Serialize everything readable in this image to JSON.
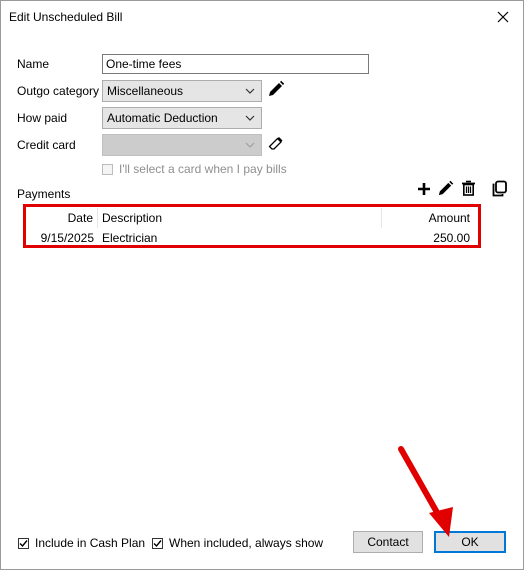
{
  "window": {
    "title": "Edit Unscheduled Bill"
  },
  "form": {
    "name_label": "Name",
    "name_value": "One-time fees",
    "category_label": "Outgo category",
    "category_value": "Miscellaneous",
    "how_paid_label": "How paid",
    "how_paid_value": "Automatic Deduction",
    "credit_card_label": "Credit card",
    "credit_card_value": "",
    "select_card_later_label": "I'll select a card when I pay bills",
    "select_card_later_checked": false
  },
  "payments": {
    "label": "Payments",
    "columns": {
      "date": "Date",
      "description": "Description",
      "amount": "Amount"
    },
    "rows": [
      {
        "date": "9/15/2025",
        "description": "Electrician",
        "amount": "250.00"
      }
    ]
  },
  "footer": {
    "include_cash_plan_label": "Include in Cash Plan",
    "include_cash_plan_checked": true,
    "always_show_label": "When included, always show",
    "always_show_checked": true,
    "contact_label": "Contact",
    "ok_label": "OK"
  },
  "colors": {
    "highlight": "#e00000",
    "accent": "#0078d7"
  },
  "icons": [
    "close-icon",
    "pencil-icon",
    "eraser-icon",
    "plus-icon",
    "trash-icon",
    "copy-icon",
    "chevron-down-icon",
    "checkmark-icon"
  ]
}
